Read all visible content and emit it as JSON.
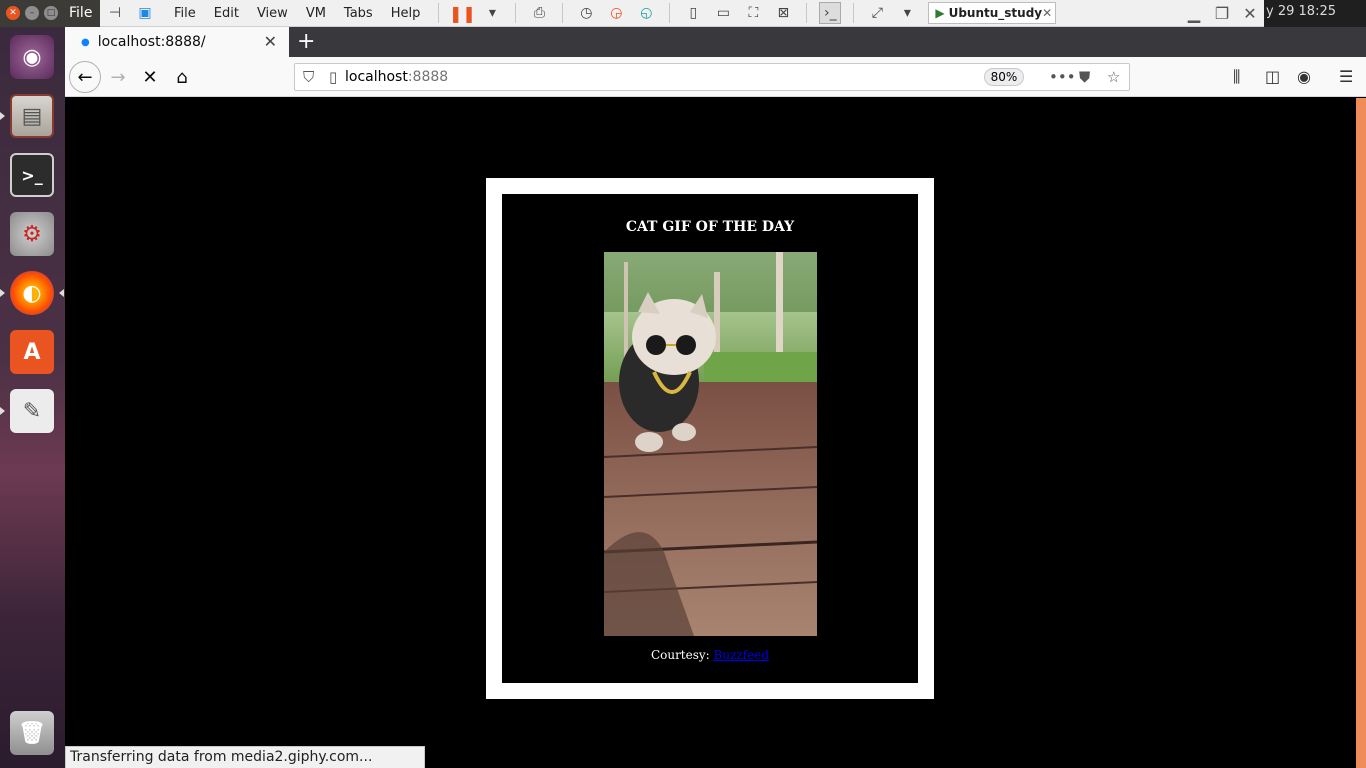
{
  "vm": {
    "file_label": "File",
    "menu": [
      "File",
      "Edit",
      "View",
      "VM",
      "Tabs",
      "Help"
    ],
    "tab_label": "Ubuntu_study",
    "clock": "y 29 18:25"
  },
  "launcher": {
    "apps": [
      "ubuntu-dash",
      "files",
      "terminal",
      "system-settings",
      "firefox",
      "software-center",
      "text-editor",
      "trash"
    ]
  },
  "browser": {
    "tab_title": "localhost:8888/",
    "url_host": "localhost",
    "url_port": ":8888",
    "zoom": "80%"
  },
  "page": {
    "title": "CAT GIF OF THE DAY",
    "credit_prefix": "Courtesy: ",
    "credit_link": "Buzzfeed"
  },
  "status": "Transferring data from media2.giphy.com...",
  "colors": {
    "ubuntu_orange": "#e95420",
    "firefox_accent": "#0a84ff",
    "page_bg": "#000000"
  }
}
